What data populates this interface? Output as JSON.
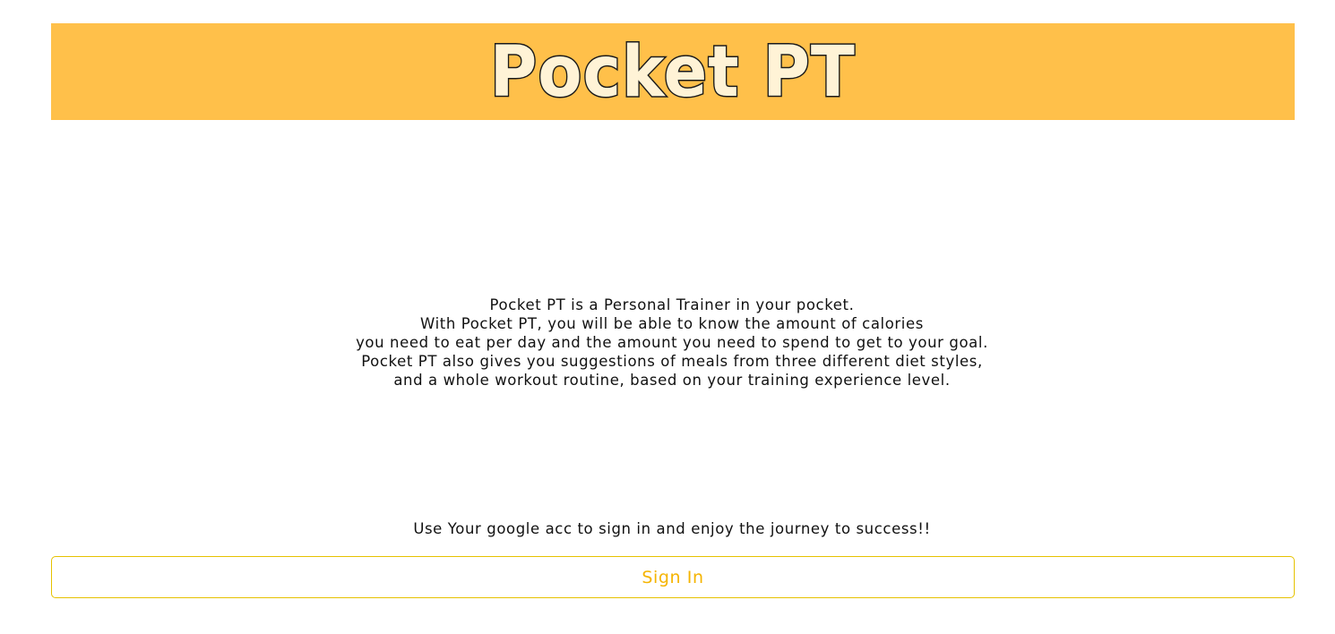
{
  "header": {
    "title": "Pocket PT"
  },
  "description": {
    "lines": [
      "Pocket PT is a Personal Trainer in your pocket.",
      "With Pocket PT, you will be able to know the amount of calories",
      "you need to eat per day and the amount you need to spend to get to your goal.",
      "Pocket PT also gives you suggestions of meals from three different diet styles,",
      "and a whole workout routine, based on your training experience level."
    ]
  },
  "signin": {
    "prompt": "Use Your google acc to sign in and enjoy the journey to success!!",
    "button_label": "Sign In"
  },
  "colors": {
    "header_background": "#FFC04A",
    "button_text": "#F5B400",
    "button_border": "#E6C200"
  }
}
